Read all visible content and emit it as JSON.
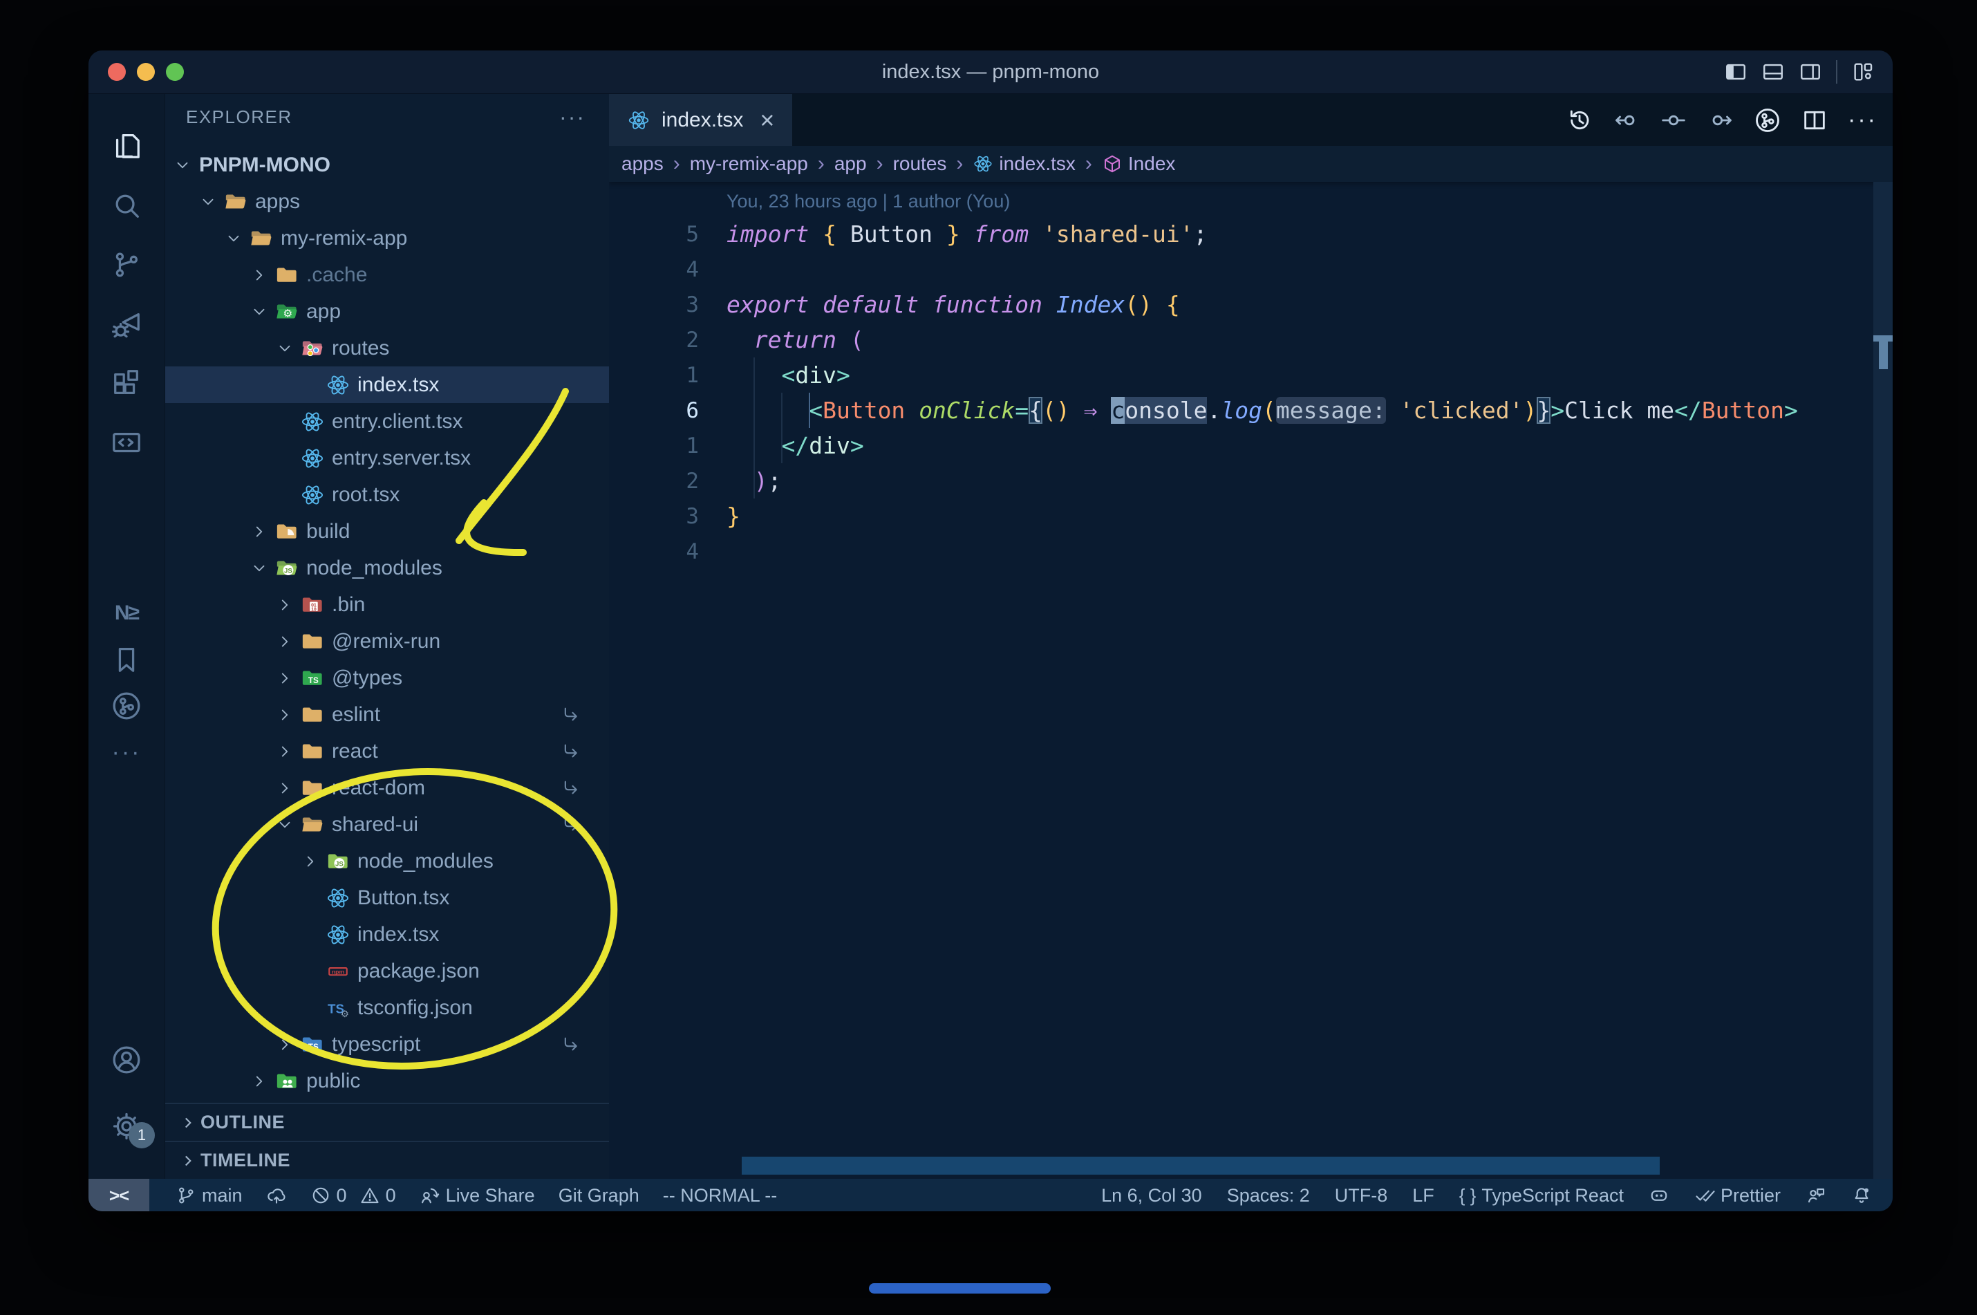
{
  "window": {
    "title": "index.tsx — pnpm-mono"
  },
  "titlebar": {
    "traffic_lights": [
      {
        "name": "close",
        "color": "#ee6a5f"
      },
      {
        "name": "minimize",
        "color": "#f5bd4f"
      },
      {
        "name": "zoom",
        "color": "#61c454"
      }
    ],
    "layout_icons": [
      "layout-sidebar-left",
      "layout-panel",
      "layout-sidebar-right",
      "sep",
      "layout-grid"
    ]
  },
  "activity_bar": {
    "top": [
      {
        "name": "explorer",
        "icon": "files",
        "active": true
      },
      {
        "name": "search",
        "icon": "search",
        "active": false
      },
      {
        "name": "source-control",
        "icon": "scm",
        "active": false
      },
      {
        "name": "run-debug",
        "icon": "debug",
        "active": false
      },
      {
        "name": "extensions",
        "icon": "extensions",
        "active": false
      },
      {
        "name": "remote-explorer",
        "icon": "remote",
        "active": false
      },
      {
        "name": "nx-console",
        "icon": "nx",
        "active": false
      },
      {
        "name": "bookmarks",
        "icon": "bookmark",
        "active": false
      },
      {
        "name": "git-graph",
        "icon": "gitgraph-circle",
        "active": false
      },
      {
        "name": "more-views",
        "icon": "ellipsis",
        "active": false
      }
    ],
    "bottom": [
      {
        "name": "account",
        "icon": "account"
      },
      {
        "name": "settings",
        "icon": "gear",
        "badge": "1"
      }
    ]
  },
  "sidebar": {
    "header": "EXPLORER",
    "sections": {
      "outline": "OUTLINE",
      "timeline": "TIMELINE"
    },
    "tree": [
      {
        "label": "PNPM-MONO",
        "depth": 0,
        "chevron": "down",
        "icon": null,
        "root": true
      },
      {
        "label": "apps",
        "depth": 1,
        "chevron": "down",
        "icon": "folder-open-tan"
      },
      {
        "label": "my-remix-app",
        "depth": 2,
        "chevron": "down",
        "icon": "folder-open-tan"
      },
      {
        "label": ".cache",
        "depth": 3,
        "chevron": "right",
        "icon": "folder-tan",
        "dim": true
      },
      {
        "label": "app",
        "depth": 3,
        "chevron": "down",
        "icon": "folder-open-app"
      },
      {
        "label": "routes",
        "depth": 4,
        "chevron": "down",
        "icon": "folder-open-routes"
      },
      {
        "label": "index.tsx",
        "depth": 5,
        "chevron": null,
        "icon": "react",
        "selected": true
      },
      {
        "label": "entry.client.tsx",
        "depth": 4,
        "chevron": null,
        "icon": "react"
      },
      {
        "label": "entry.server.tsx",
        "depth": 4,
        "chevron": null,
        "icon": "react"
      },
      {
        "label": "root.tsx",
        "depth": 4,
        "chevron": null,
        "icon": "react"
      },
      {
        "label": "build",
        "depth": 3,
        "chevron": "right",
        "icon": "folder-build"
      },
      {
        "label": "node_modules",
        "depth": 3,
        "chevron": "down",
        "icon": "folder-open-js"
      },
      {
        "label": ".bin",
        "depth": 4,
        "chevron": "right",
        "icon": "folder-bin"
      },
      {
        "label": "@remix-run",
        "depth": 4,
        "chevron": "right",
        "icon": "folder-tan"
      },
      {
        "label": "@types",
        "depth": 4,
        "chevron": "right",
        "icon": "folder-ts"
      },
      {
        "label": "eslint",
        "depth": 4,
        "chevron": "right",
        "icon": "folder-tan",
        "symlink": true
      },
      {
        "label": "react",
        "depth": 4,
        "chevron": "right",
        "icon": "folder-tan",
        "symlink": true
      },
      {
        "label": "react-dom",
        "depth": 4,
        "chevron": "right",
        "icon": "folder-tan",
        "symlink": true
      },
      {
        "label": "shared-ui",
        "depth": 4,
        "chevron": "down",
        "icon": "folder-open-tan",
        "symlink": true
      },
      {
        "label": "node_modules",
        "depth": 5,
        "chevron": "right",
        "icon": "folder-js"
      },
      {
        "label": "Button.tsx",
        "depth": 5,
        "chevron": null,
        "icon": "react"
      },
      {
        "label": "index.tsx",
        "depth": 5,
        "chevron": null,
        "icon": "react"
      },
      {
        "label": "package.json",
        "depth": 5,
        "chevron": null,
        "icon": "npm"
      },
      {
        "label": "tsconfig.json",
        "depth": 5,
        "chevron": null,
        "icon": "tsconfig"
      },
      {
        "label": "typescript",
        "depth": 4,
        "chevron": "right",
        "icon": "folder-blue",
        "symlink": true
      },
      {
        "label": "public",
        "depth": 3,
        "chevron": "right",
        "icon": "folder-public"
      }
    ]
  },
  "editor_tabs": {
    "active_tab": {
      "label": "index.tsx",
      "icon": "react",
      "close": "×"
    },
    "actions": [
      {
        "name": "timeline-history",
        "icon": "history",
        "bright": true
      },
      {
        "name": "previous-change",
        "icon": "prev-change",
        "bright": false
      },
      {
        "name": "current-change",
        "icon": "change",
        "bright": false
      },
      {
        "name": "next-change",
        "icon": "next-change",
        "bright": false
      },
      {
        "name": "git-graph-view",
        "icon": "gitgraph-circle",
        "bright": true
      },
      {
        "name": "split-editor",
        "icon": "split",
        "bright": true
      },
      {
        "name": "more-actions",
        "icon": "ellipsis",
        "bright": true
      }
    ]
  },
  "breadcrumbs": {
    "separator": "›",
    "items": [
      {
        "label": "apps",
        "icon": null
      },
      {
        "label": "my-remix-app",
        "icon": null
      },
      {
        "label": "app",
        "icon": null
      },
      {
        "label": "routes",
        "icon": null
      },
      {
        "label": "index.tsx",
        "icon": "react"
      },
      {
        "label": "Index",
        "icon": "symbol-module"
      }
    ]
  },
  "editor": {
    "blame": "You, 23 hours ago | 1 author (You)",
    "cursor_position": {
      "line": 6,
      "col": 30
    },
    "lines": [
      {
        "num": "5",
        "tokens": [
          {
            "t": "import ",
            "c": "k"
          },
          {
            "t": "{",
            "c": "y"
          },
          {
            "t": " Button ",
            "c": "w"
          },
          {
            "t": "}",
            "c": "y"
          },
          {
            "t": " ",
            "c": "w"
          },
          {
            "t": "from",
            "c": "k"
          },
          {
            "t": " ",
            "c": "w"
          },
          {
            "t": "'shared-ui'",
            "c": "str"
          },
          {
            "t": ";",
            "c": "w"
          }
        ]
      },
      {
        "num": "4",
        "tokens": []
      },
      {
        "num": "3",
        "tokens": [
          {
            "t": "export ",
            "c": "k"
          },
          {
            "t": "default ",
            "c": "k"
          },
          {
            "t": "function ",
            "c": "k"
          },
          {
            "t": "Index",
            "c": "fn"
          },
          {
            "t": "()",
            "c": "y"
          },
          {
            "t": " ",
            "c": "w"
          },
          {
            "t": "{",
            "c": "y"
          }
        ]
      },
      {
        "num": "2",
        "tokens": [
          {
            "t": "  ",
            "c": "w"
          },
          {
            "t": "return",
            "c": "k"
          },
          {
            "t": " ",
            "c": "w"
          },
          {
            "t": "(",
            "c": "p"
          }
        ]
      },
      {
        "num": "1",
        "tokens": [
          {
            "t": "    ",
            "c": "w"
          },
          {
            "t": "<",
            "c": "t"
          },
          {
            "t": "div",
            "c": "tag"
          },
          {
            "t": ">",
            "c": "t"
          }
        ]
      },
      {
        "num": "6",
        "current": true,
        "tokens": [
          {
            "t": "      ",
            "c": "w"
          },
          {
            "t": "<",
            "c": "t"
          },
          {
            "t": "Button",
            "c": "cmp"
          },
          {
            "t": " ",
            "c": "w"
          },
          {
            "t": "onClick",
            "c": "attr"
          },
          {
            "t": "=",
            "c": "t"
          },
          {
            "t": "{",
            "c": "w",
            "box": true
          },
          {
            "t": "()",
            "c": "y"
          },
          {
            "t": " ",
            "c": "w"
          },
          {
            "t": "⇒",
            "c": "k2"
          },
          {
            "t": " ",
            "c": "w"
          },
          {
            "t": "c",
            "c": "w",
            "cursor": true
          },
          {
            "t": "onsole",
            "c": "w",
            "hl": true
          },
          {
            "t": ".",
            "c": "w"
          },
          {
            "t": "log",
            "c": "fn"
          },
          {
            "t": "(",
            "c": "y"
          },
          {
            "t": "message:",
            "c": "w",
            "inlay": true
          },
          {
            "t": " ",
            "c": "w"
          },
          {
            "t": "'clicked'",
            "c": "str"
          },
          {
            "t": ")",
            "c": "y"
          },
          {
            "t": "}",
            "c": "w",
            "box": true
          },
          {
            "t": ">",
            "c": "t"
          },
          {
            "t": "Click me",
            "c": "w"
          },
          {
            "t": "</",
            "c": "t"
          },
          {
            "t": "Button",
            "c": "cmp"
          },
          {
            "t": ">",
            "c": "t"
          }
        ]
      },
      {
        "num": "1",
        "tokens": [
          {
            "t": "    ",
            "c": "w"
          },
          {
            "t": "</",
            "c": "t"
          },
          {
            "t": "div",
            "c": "tag"
          },
          {
            "t": ">",
            "c": "t"
          }
        ]
      },
      {
        "num": "2",
        "tokens": [
          {
            "t": "  ",
            "c": "w"
          },
          {
            "t": ")",
            "c": "p"
          },
          {
            "t": ";",
            "c": "w"
          }
        ]
      },
      {
        "num": "3",
        "tokens": [
          {
            "t": "}",
            "c": "y"
          }
        ]
      },
      {
        "num": "4",
        "tokens": []
      }
    ]
  },
  "status_bar": {
    "remote": "><",
    "left": [
      {
        "name": "git-branch",
        "icon": "git-branch",
        "label": "main"
      },
      {
        "name": "sync",
        "icon": "cloud-upload",
        "label": ""
      },
      {
        "name": "problems",
        "icon": "error",
        "label": "0",
        "icon2": "warning",
        "label2": "0"
      },
      {
        "name": "live-share",
        "icon": "live-share",
        "label": "Live Share"
      },
      {
        "name": "git-graph",
        "icon": null,
        "label": "Git Graph"
      },
      {
        "name": "vim-mode",
        "icon": null,
        "label": "-- NORMAL --"
      }
    ],
    "right": [
      {
        "name": "cursor-position",
        "icon": null,
        "label": "Ln 6, Col 30"
      },
      {
        "name": "indentation",
        "icon": null,
        "label": "Spaces: 2"
      },
      {
        "name": "encoding",
        "icon": null,
        "label": "UTF-8"
      },
      {
        "name": "eol",
        "icon": null,
        "label": "LF"
      },
      {
        "name": "language-mode",
        "icon": "braces",
        "label": "TypeScript React"
      },
      {
        "name": "copilot",
        "icon": "copilot",
        "label": ""
      },
      {
        "name": "prettier",
        "icon": "double-check",
        "label": "Prettier"
      },
      {
        "name": "feedback",
        "icon": "feedback",
        "label": ""
      },
      {
        "name": "notifications",
        "icon": "bell-dot",
        "label": ""
      }
    ]
  },
  "annotations": {
    "color": "#e9e532"
  },
  "colors": {
    "editor_bg": "#0a1b30",
    "sidebar_bg": "#0c1d31",
    "statusbar_bg": "#0f2944",
    "titlebar_bg": "#0f1d31",
    "selection_bg": "#1d3250",
    "accent_yellow": "#e9e532",
    "react_blue": "#56b8ee",
    "folder_tan": "#deb068",
    "scrollbar_blue": "#17466f"
  }
}
